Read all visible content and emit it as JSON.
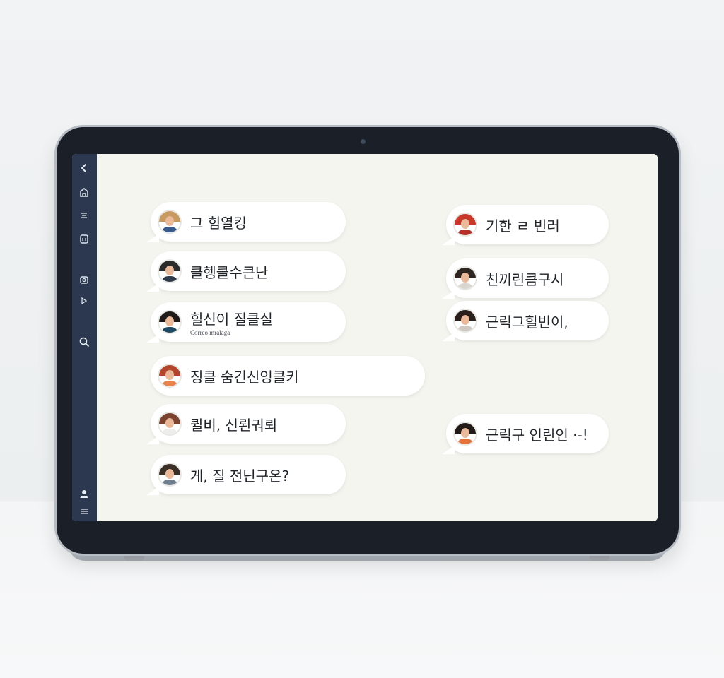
{
  "sidebar": {
    "icons": [
      "chevron-left-icon",
      "home-icon",
      "chat-icon",
      "contacts-icon",
      "camera-icon",
      "send-icon",
      "search-icon",
      "profile-icon",
      "menu-icon"
    ]
  },
  "left_messages": [
    {
      "text": "그 힘열킹",
      "sub": "",
      "hair": "#c89a5f",
      "shirt": "#3a5a8a"
    },
    {
      "text": "클헹클수큰난",
      "sub": "",
      "hair": "#2b2b2b",
      "shirt": "#2f3a4a"
    },
    {
      "text": "힐신이 질클실",
      "sub": "Correo mralaga",
      "hair": "#1f1a17",
      "shirt": "#1f4a63"
    },
    {
      "text": "징클 숨긴신잉클키",
      "sub": "",
      "hair": "#b2452c",
      "shirt": "#e6834e"
    },
    {
      "text": "퀼비, 신뢴궈뢰",
      "sub": "",
      "hair": "#7b4330",
      "shirt": "#ededed"
    },
    {
      "text": "게, 질 전닌구온?",
      "sub": "",
      "hair": "#3a3028",
      "shirt": "#6f7f8f"
    }
  ],
  "right_messages": [
    {
      "text": "기한 ㄹ 빈러",
      "sub": "",
      "hair": "#c8372a",
      "shirt": "#b3312a"
    },
    {
      "text": "친끼린큼구시",
      "sub": "",
      "hair": "#2e2420",
      "shirt": "#d9d5cf"
    },
    {
      "text": "근릭그힐빈이,",
      "sub": "",
      "hair": "#2a1f1b",
      "shirt": "#cfc9c2"
    },
    {
      "text": "근릭구 인린인 ·-!",
      "sub": "",
      "hair": "#231b17",
      "shirt": "#e2733f"
    }
  ]
}
